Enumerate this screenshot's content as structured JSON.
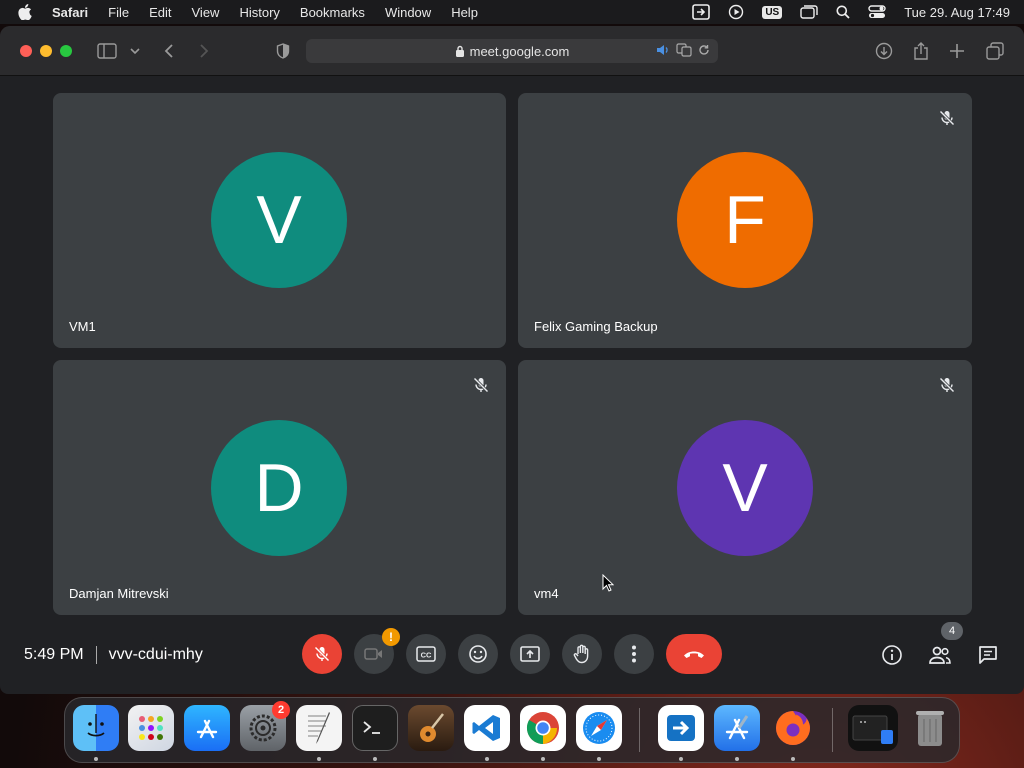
{
  "menubar": {
    "app_name": "Safari",
    "menus": [
      "File",
      "Edit",
      "View",
      "History",
      "Bookmarks",
      "Window",
      "Help"
    ],
    "input_source": "US",
    "clock": "Tue 29. Aug  17:49"
  },
  "browser": {
    "url": "meet.google.com"
  },
  "meeting": {
    "time": "5:49 PM",
    "code": "vvv-cdui-mhy",
    "people_count": "4",
    "camera_warning": "!",
    "participants": [
      {
        "name": "VM1",
        "initial": "V",
        "color": "#0f8c7e",
        "muted": false
      },
      {
        "name": "Felix Gaming Backup",
        "initial": "F",
        "color": "#ef6c00",
        "muted": true
      },
      {
        "name": "Damjan Mitrevski",
        "initial": "D",
        "color": "#0f8c7e",
        "muted": true
      },
      {
        "name": "vm4",
        "initial": "V",
        "color": "#5e35b1",
        "muted": true
      }
    ]
  },
  "dock": {
    "settings_badge": "2"
  }
}
